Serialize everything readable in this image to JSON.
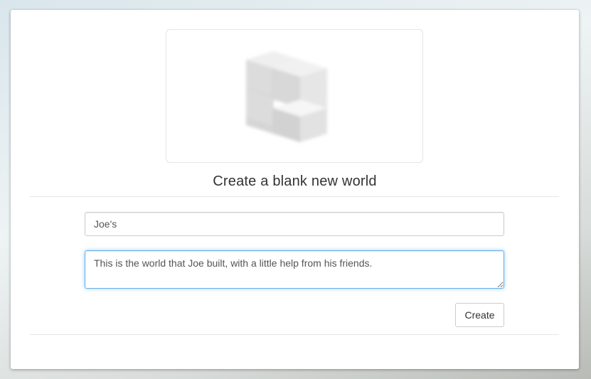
{
  "form": {
    "title": "Create a blank new world",
    "name_value": "Joe's",
    "description_value": "This is the world that Joe built, with a little help from his friends.",
    "create_label": "Create"
  },
  "preview": {
    "icon": "cube-blocks-icon"
  },
  "colors": {
    "focus_border": "#66afe9",
    "divider": "#e5e5e5",
    "text": "#333333"
  }
}
